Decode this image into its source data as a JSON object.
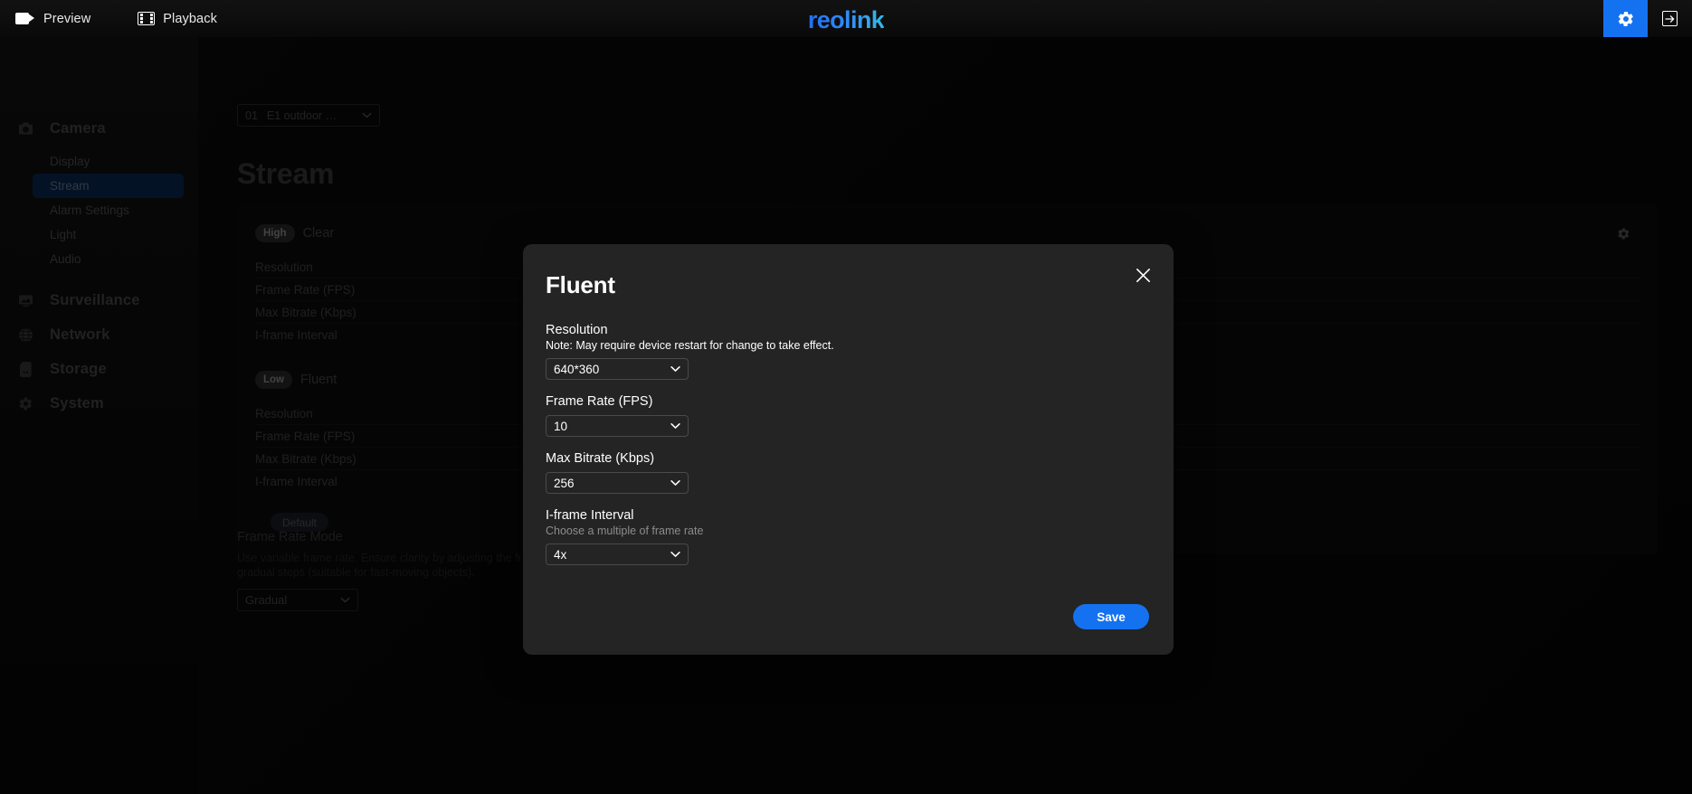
{
  "topbar": {
    "nav": [
      {
        "label": "Preview",
        "icon": "camera-icon"
      },
      {
        "label": "Playback",
        "icon": "film-icon"
      }
    ],
    "brand": "reolink",
    "settings_icon": "gear-icon",
    "logout_icon": "logout-icon",
    "accent": "#1472f0"
  },
  "sidebar": {
    "groups": [
      {
        "label": "Camera",
        "icon": "camera-icon",
        "items": [
          {
            "label": "Display",
            "active": false
          },
          {
            "label": "Stream",
            "active": true
          },
          {
            "label": "Alarm Settings",
            "active": false
          },
          {
            "label": "Light",
            "active": false
          },
          {
            "label": "Audio",
            "active": false
          }
        ]
      },
      {
        "label": "Surveillance",
        "icon": "monitor-icon",
        "items": []
      },
      {
        "label": "Network",
        "icon": "globe-icon",
        "items": []
      },
      {
        "label": "Storage",
        "icon": "sdcard-icon",
        "items": []
      },
      {
        "label": "System",
        "icon": "gear-icon",
        "items": []
      }
    ],
    "active_color": "#0b2a55"
  },
  "main": {
    "camera_select": {
      "number": "01",
      "name": "E1 outdoor …",
      "icon": "chevron-down-icon"
    },
    "page_title": "Stream",
    "streams": [
      {
        "badge": "High",
        "name": "Clear",
        "gear_icon": "gear-icon",
        "rows": [
          "Resolution",
          "Frame Rate (FPS)",
          "Max Bitrate (Kbps)",
          "I-frame Interval"
        ]
      },
      {
        "badge": "Low",
        "name": "Fluent",
        "gear_icon": "gear-icon",
        "rows": [
          "Resolution",
          "Frame Rate (FPS)",
          "Max Bitrate (Kbps)",
          "I-frame Interval"
        ]
      }
    ],
    "default_button": "Default",
    "frame_rate_mode": {
      "title": "Frame Rate Mode",
      "description": "Use variable frame rate. Ensure clarity by adjusting the frame rate in gradual steps (suitable for fast-moving objects).",
      "value": "Gradual"
    }
  },
  "modal": {
    "title": "Fluent",
    "close_icon": "close-icon",
    "fields": [
      {
        "label": "Resolution",
        "note": "Note: May require device restart for change to take effect.",
        "note_dim": false,
        "value": "640*360"
      },
      {
        "label": "Frame Rate (FPS)",
        "note": "",
        "note_dim": false,
        "value": "10"
      },
      {
        "label": "Max Bitrate (Kbps)",
        "note": "",
        "note_dim": false,
        "value": "256"
      },
      {
        "label": "I-frame Interval",
        "note": "Choose a multiple of frame rate",
        "note_dim": true,
        "value": "4x"
      }
    ],
    "save_label": "Save",
    "accent": "#1472f0"
  }
}
